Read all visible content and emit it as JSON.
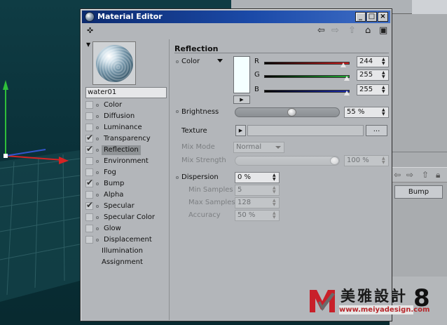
{
  "window": {
    "title": "Material Editor",
    "buttons": {
      "minimize": "_",
      "maximize": "□",
      "close": "×"
    }
  },
  "material": {
    "name": "water01"
  },
  "channels": [
    {
      "label": "Color",
      "checked": false
    },
    {
      "label": "Diffusion",
      "checked": false
    },
    {
      "label": "Luminance",
      "checked": false
    },
    {
      "label": "Transparency",
      "checked": true
    },
    {
      "label": "Reflection",
      "checked": true,
      "selected": true
    },
    {
      "label": "Environment",
      "checked": false
    },
    {
      "label": "Fog",
      "checked": false
    },
    {
      "label": "Bump",
      "checked": true
    },
    {
      "label": "Alpha",
      "checked": false
    },
    {
      "label": "Specular",
      "checked": true
    },
    {
      "label": "Specular Color",
      "checked": false
    },
    {
      "label": "Glow",
      "checked": false
    },
    {
      "label": "Displacement",
      "checked": false
    },
    {
      "label": "Illumination",
      "plain": true
    },
    {
      "label": "Assignment",
      "plain": true
    }
  ],
  "reflection": {
    "section_title": "Reflection",
    "color_label": "Color",
    "swatch_color": "#f4ffff",
    "r": {
      "label": "R",
      "value": "244",
      "fraction": 0.957
    },
    "g": {
      "label": "G",
      "value": "255",
      "fraction": 1.0
    },
    "b": {
      "label": "B",
      "value": "255",
      "fraction": 1.0
    },
    "brightness_label": "Brightness",
    "brightness_value": "55 %",
    "brightness_fraction": 0.55,
    "texture_label": "Texture",
    "texture_more": "...",
    "mix_mode_label": "Mix Mode",
    "mix_mode_value": "Normal",
    "mix_strength_label": "Mix Strength",
    "mix_strength_value": "100 %",
    "mix_strength_fraction": 1.0,
    "dispersion_label": "Dispersion",
    "dispersion_value": "0 %",
    "min_samples_label": "Min Samples",
    "min_samples_value": "5",
    "max_samples_label": "Max Samples",
    "max_samples_value": "128",
    "accuracy_label": "Accuracy",
    "accuracy_value": "50 %"
  },
  "background": {
    "bump_button": "Bump"
  },
  "watermark": {
    "title": "美雅設計",
    "url": "www.meiyadesign.com",
    "number": "8"
  },
  "colors": {
    "title_bar": "#1b4aa8",
    "red": "#d21e1e",
    "green": "#1eaa32",
    "blue": "#1a2bb0"
  }
}
